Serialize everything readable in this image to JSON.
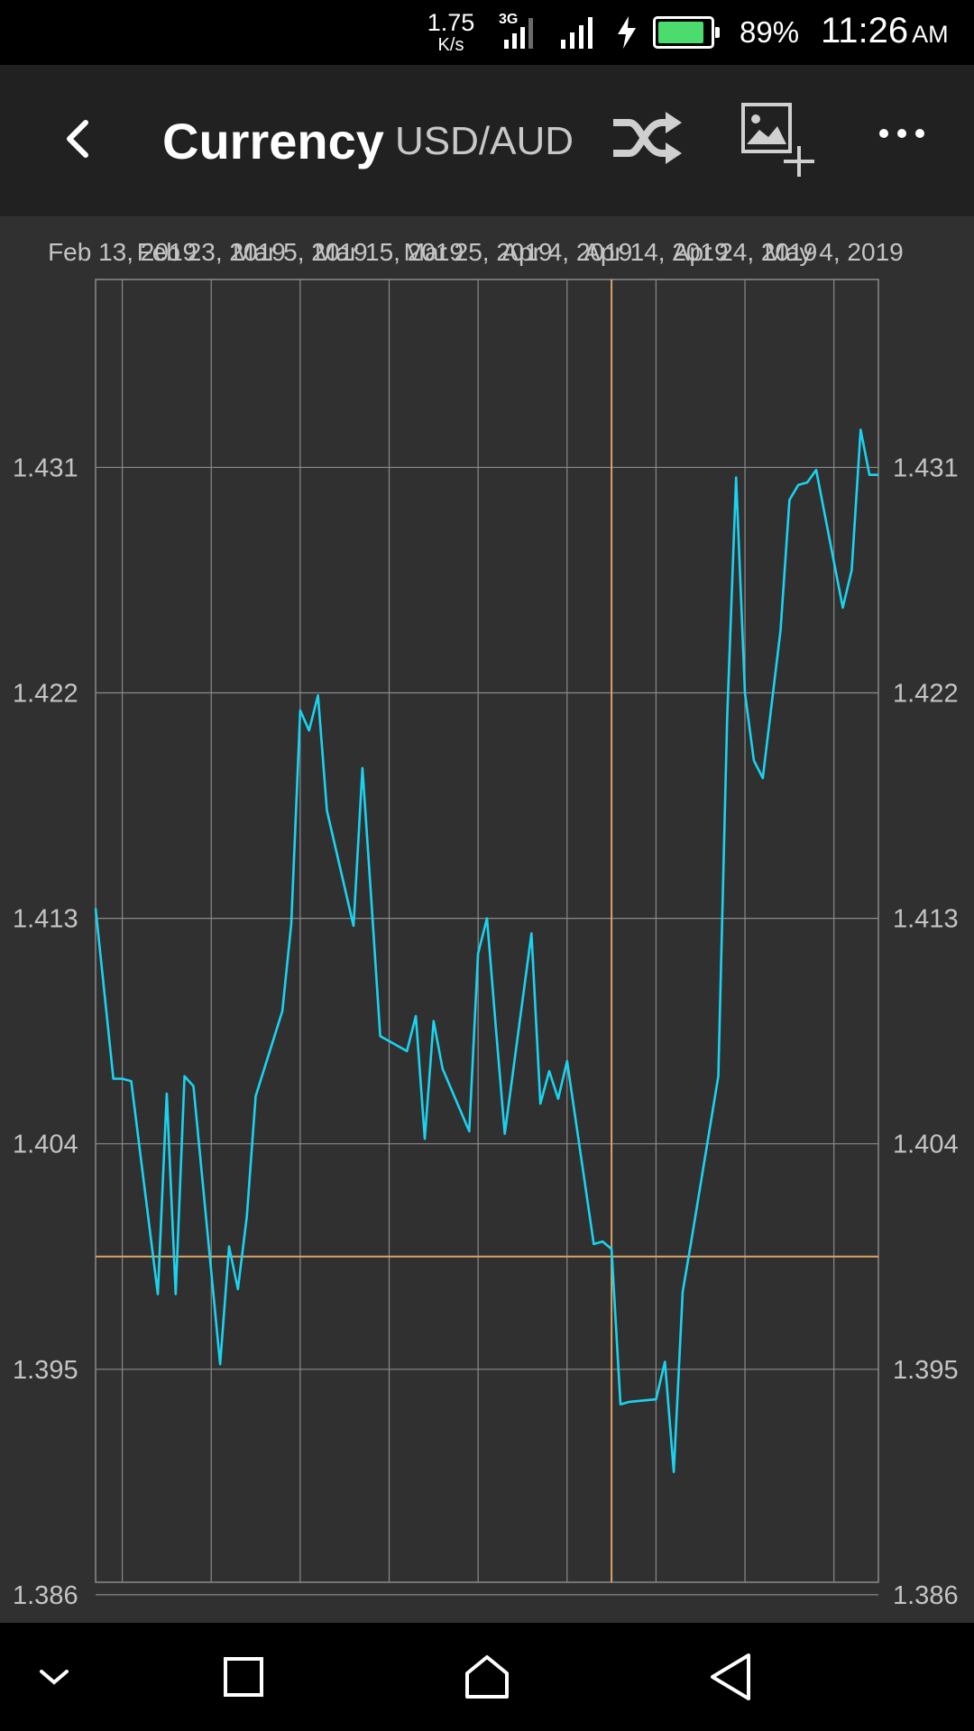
{
  "status_bar": {
    "net_speed_value": "1.75",
    "net_speed_unit": "K/s",
    "network_type": "3G",
    "battery_percent": "89%",
    "battery_level": 0.89,
    "time": "11:26",
    "ampm": "AM",
    "battery_color": "#4cdc6e"
  },
  "app_bar": {
    "title": "Currency",
    "pair": "USD/AUD",
    "icons": [
      "back-icon",
      "shuffle-icon",
      "add-image-icon",
      "more-icon"
    ]
  },
  "chart_data": {
    "type": "line",
    "x_axis_type": "date",
    "x_ticks": [
      "Feb 13, 2019",
      "Feb 23, 2019",
      "Mar 5, 2019",
      "Mar 15, 2019",
      "Mar 25, 2019",
      "Apr 4, 2019",
      "Apr 14, 2019",
      "Apr 24, 2019",
      "May 4, 2019"
    ],
    "xlim": [
      "2019-02-10",
      "2019-05-09"
    ],
    "ylim": [
      1.3865,
      1.4385
    ],
    "y_ticks": [
      1.431,
      1.422,
      1.413,
      1.404,
      1.395,
      1.386
    ],
    "y_tick_labels": [
      "1.431",
      "1.422",
      "1.413",
      "1.404",
      "1.395",
      "1.386"
    ],
    "y_axis_both_sides": true,
    "grid": true,
    "crosshair": {
      "x": "2019-04-09",
      "y": 1.3995
    },
    "series": [
      {
        "color": "#1ad3f0",
        "x": [
          "2019-02-10",
          "2019-02-12",
          "2019-02-13",
          "2019-02-14",
          "2019-02-17",
          "2019-02-18",
          "2019-02-19",
          "2019-02-20",
          "2019-02-21",
          "2019-02-24",
          "2019-02-25",
          "2019-02-26",
          "2019-02-27",
          "2019-02-28",
          "2019-03-03",
          "2019-03-04",
          "2019-03-05",
          "2019-03-06",
          "2019-03-07",
          "2019-03-08",
          "2019-03-11",
          "2019-03-12",
          "2019-03-13",
          "2019-03-14",
          "2019-03-17",
          "2019-03-18",
          "2019-03-19",
          "2019-03-20",
          "2019-03-21",
          "2019-03-24",
          "2019-03-25",
          "2019-03-26",
          "2019-03-27",
          "2019-03-28",
          "2019-03-31",
          "2019-04-01",
          "2019-04-02",
          "2019-04-03",
          "2019-04-04",
          "2019-04-07",
          "2019-04-08",
          "2019-04-09",
          "2019-04-10",
          "2019-04-11",
          "2019-04-14",
          "2019-04-15",
          "2019-04-16",
          "2019-04-17",
          "2019-04-18",
          "2019-04-21",
          "2019-04-22",
          "2019-04-23",
          "2019-04-24",
          "2019-04-25",
          "2019-04-26",
          "2019-04-28",
          "2019-04-29",
          "2019-04-30",
          "2019-05-01",
          "2019-05-02",
          "2019-05-05",
          "2019-05-06",
          "2019-05-07",
          "2019-05-08",
          "2019-05-09"
        ],
        "values": [
          1.4134,
          1.4066,
          1.4066,
          1.4065,
          1.398,
          1.406,
          1.398,
          1.4067,
          1.4063,
          1.3952,
          1.3999,
          1.3982,
          1.4011,
          1.4059,
          1.4093,
          1.4128,
          1.4213,
          1.4205,
          1.4219,
          1.4173,
          1.4127,
          1.419,
          1.4137,
          1.4083,
          1.4077,
          1.4091,
          1.4042,
          1.4089,
          1.407,
          1.4045,
          1.4116,
          1.413,
          1.4086,
          1.4044,
          1.4124,
          1.4056,
          1.4069,
          1.4058,
          1.4073,
          1.4,
          1.4001,
          1.3998,
          1.3936,
          1.3937,
          1.3938,
          1.3953,
          1.3909,
          1.3981,
          1.4002,
          1.4067,
          1.421,
          1.4306,
          1.422,
          1.4193,
          1.4186,
          1.4245,
          1.4297,
          1.4303,
          1.4304,
          1.4309,
          1.4254,
          1.4269,
          1.4325,
          1.4307,
          1.4307
        ]
      }
    ]
  },
  "colors": {
    "chart_bg": "#303030",
    "grid": "#8a8a8a",
    "crosshair": "#d9a46a",
    "axis_text": "#c4c4c4",
    "app_bar_bg": "#212121"
  },
  "nav_bar": {
    "icons": [
      "collapse-icon",
      "recents-icon",
      "home-icon",
      "back-triangle-icon"
    ]
  }
}
